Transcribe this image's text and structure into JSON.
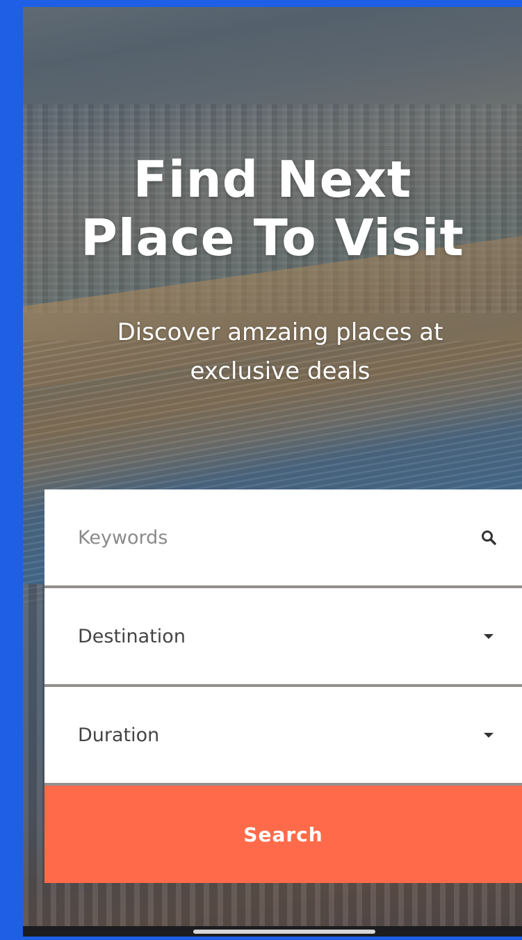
{
  "hero": {
    "title_line1": "Find Next",
    "title_line2": "Place To Visit",
    "subtitle_line1": "Discover amzaing places at",
    "subtitle_line2": "exclusive deals"
  },
  "search_form": {
    "keywords": {
      "placeholder": "Keywords",
      "value": "",
      "icon": "search-icon"
    },
    "destination": {
      "selected": "Destination",
      "icon": "chevron-down-icon"
    },
    "duration": {
      "selected": "Duration",
      "icon": "chevron-down-icon"
    },
    "submit_label": "Search"
  },
  "colors": {
    "frame_border": "#1e5fe6",
    "accent": "#ff6b4a",
    "field_background": "#ffffff"
  }
}
